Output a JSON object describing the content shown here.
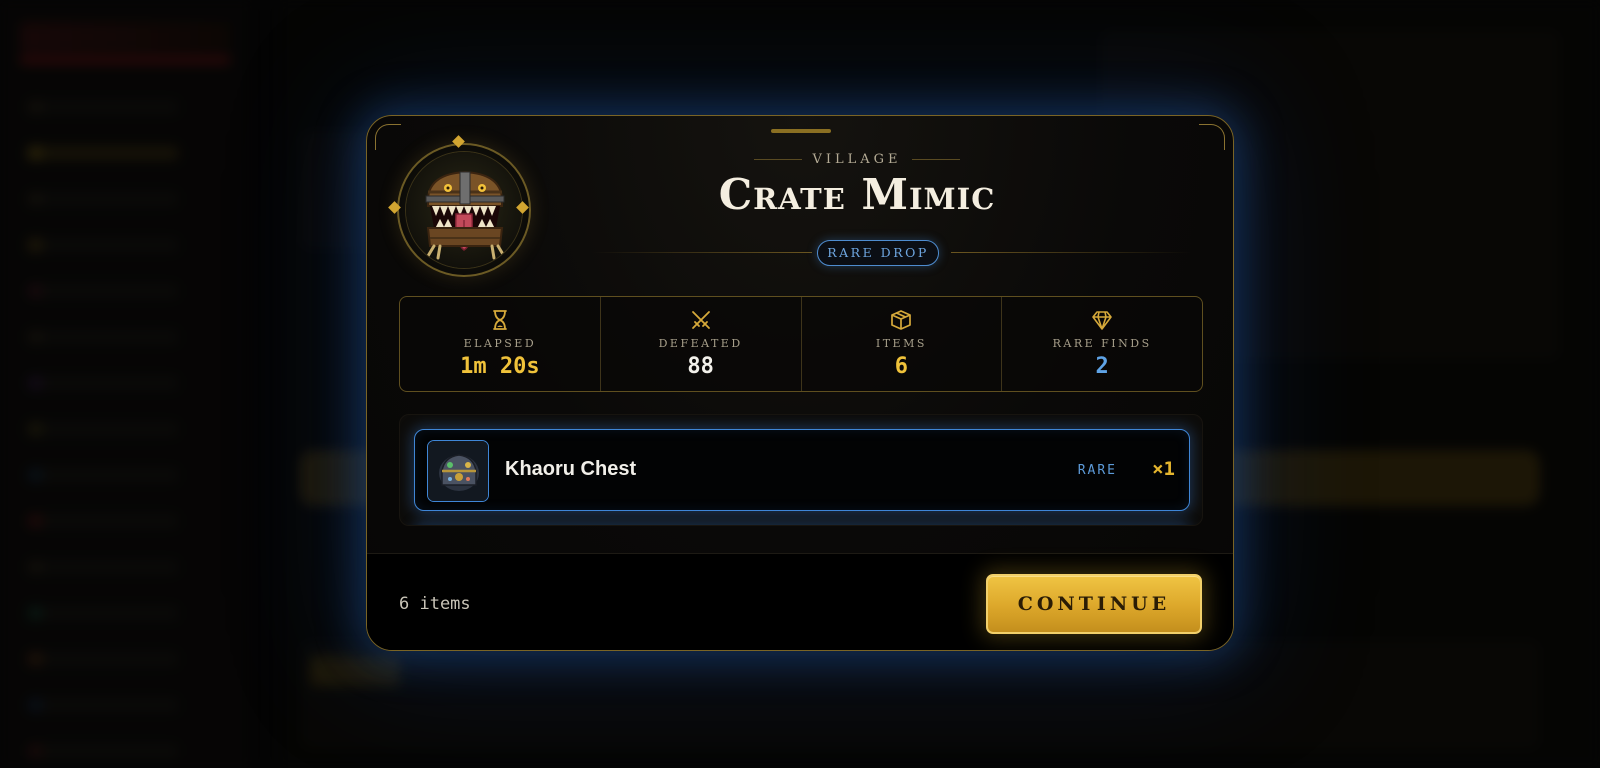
{
  "encounter": {
    "zone": "VILLAGE",
    "boss_name": "Crate Mimic",
    "drop_badge": "RARE DROP"
  },
  "stats": [
    {
      "icon": "hourglass-icon",
      "label": "ELAPSED",
      "value": "1m 20s",
      "color": "#f0c23a"
    },
    {
      "icon": "crossed-swords-icon",
      "label": "DEFEATED",
      "value": "88",
      "color": "#f2f0ea"
    },
    {
      "icon": "box-icon",
      "label": "ITEMS",
      "value": "6",
      "color": "#f0c23a"
    },
    {
      "icon": "gem-icon",
      "label": "RARE FINDS",
      "value": "2",
      "color": "#5fa3e6"
    }
  ],
  "loot": {
    "items": [
      {
        "name": "Khaoru Chest",
        "rarity": "RARE",
        "quantity": "×1"
      }
    ]
  },
  "footer": {
    "item_count": "6 items",
    "continue_label": "CONTINUE"
  },
  "colors": {
    "gold_accent": "#d2a531",
    "rare_blue": "#3f86d6",
    "button_gold": "#e2b02f"
  }
}
